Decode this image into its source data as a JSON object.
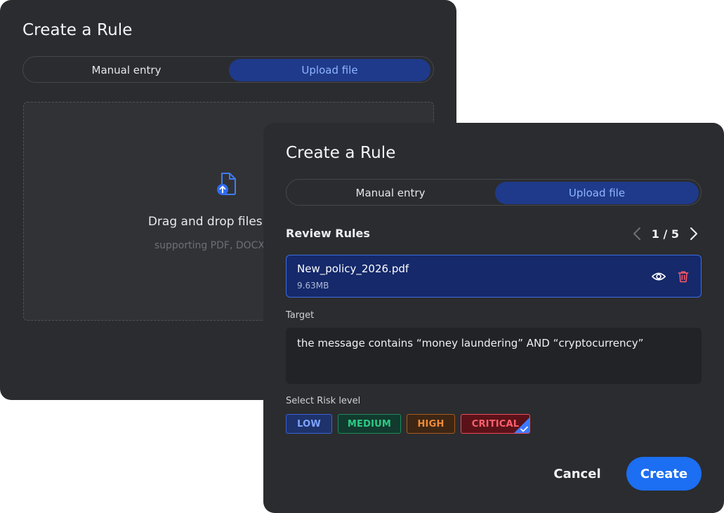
{
  "back_dialog": {
    "title": "Create a Rule",
    "tabs": [
      {
        "label": "Manual entry",
        "active": false
      },
      {
        "label": "Upload file",
        "active": true
      }
    ],
    "dropzone": {
      "title": "Drag and drop files here or",
      "subtitle": "supporting PDF, DOCX, TXT (u",
      "icon": "file-upload-icon"
    }
  },
  "front_dialog": {
    "title": "Create a Rule",
    "tabs": [
      {
        "label": "Manual entry",
        "active": false
      },
      {
        "label": "Upload file",
        "active": true
      }
    ],
    "review_label": "Review Rules",
    "pager": {
      "text": "1 / 5",
      "current": 1,
      "total": 5
    },
    "file": {
      "name": "New_policy_2026.pdf",
      "size": "9.63MB"
    },
    "target_label": "Target",
    "target_value": "the message contains “money laundering” AND “cryptocurrency”",
    "risk_label": "Select Risk level",
    "risk_levels": [
      {
        "label": "LOW",
        "selected": false
      },
      {
        "label": "MEDIUM",
        "selected": false
      },
      {
        "label": "HIGH",
        "selected": false
      },
      {
        "label": "CRITICAL",
        "selected": true
      }
    ],
    "cancel_label": "Cancel",
    "create_label": "Create"
  },
  "colors": {
    "panel_bg": "#2b2c2f",
    "accent": "#1c6ef2",
    "active_tab_bg": "#1f3a8a",
    "active_tab_text": "#8fb4ff",
    "low": "#7ea4ff",
    "medium": "#2ccb85",
    "high": "#f08a36",
    "critical": "#ff5f6d",
    "delete_icon": "#ff5a6a"
  }
}
